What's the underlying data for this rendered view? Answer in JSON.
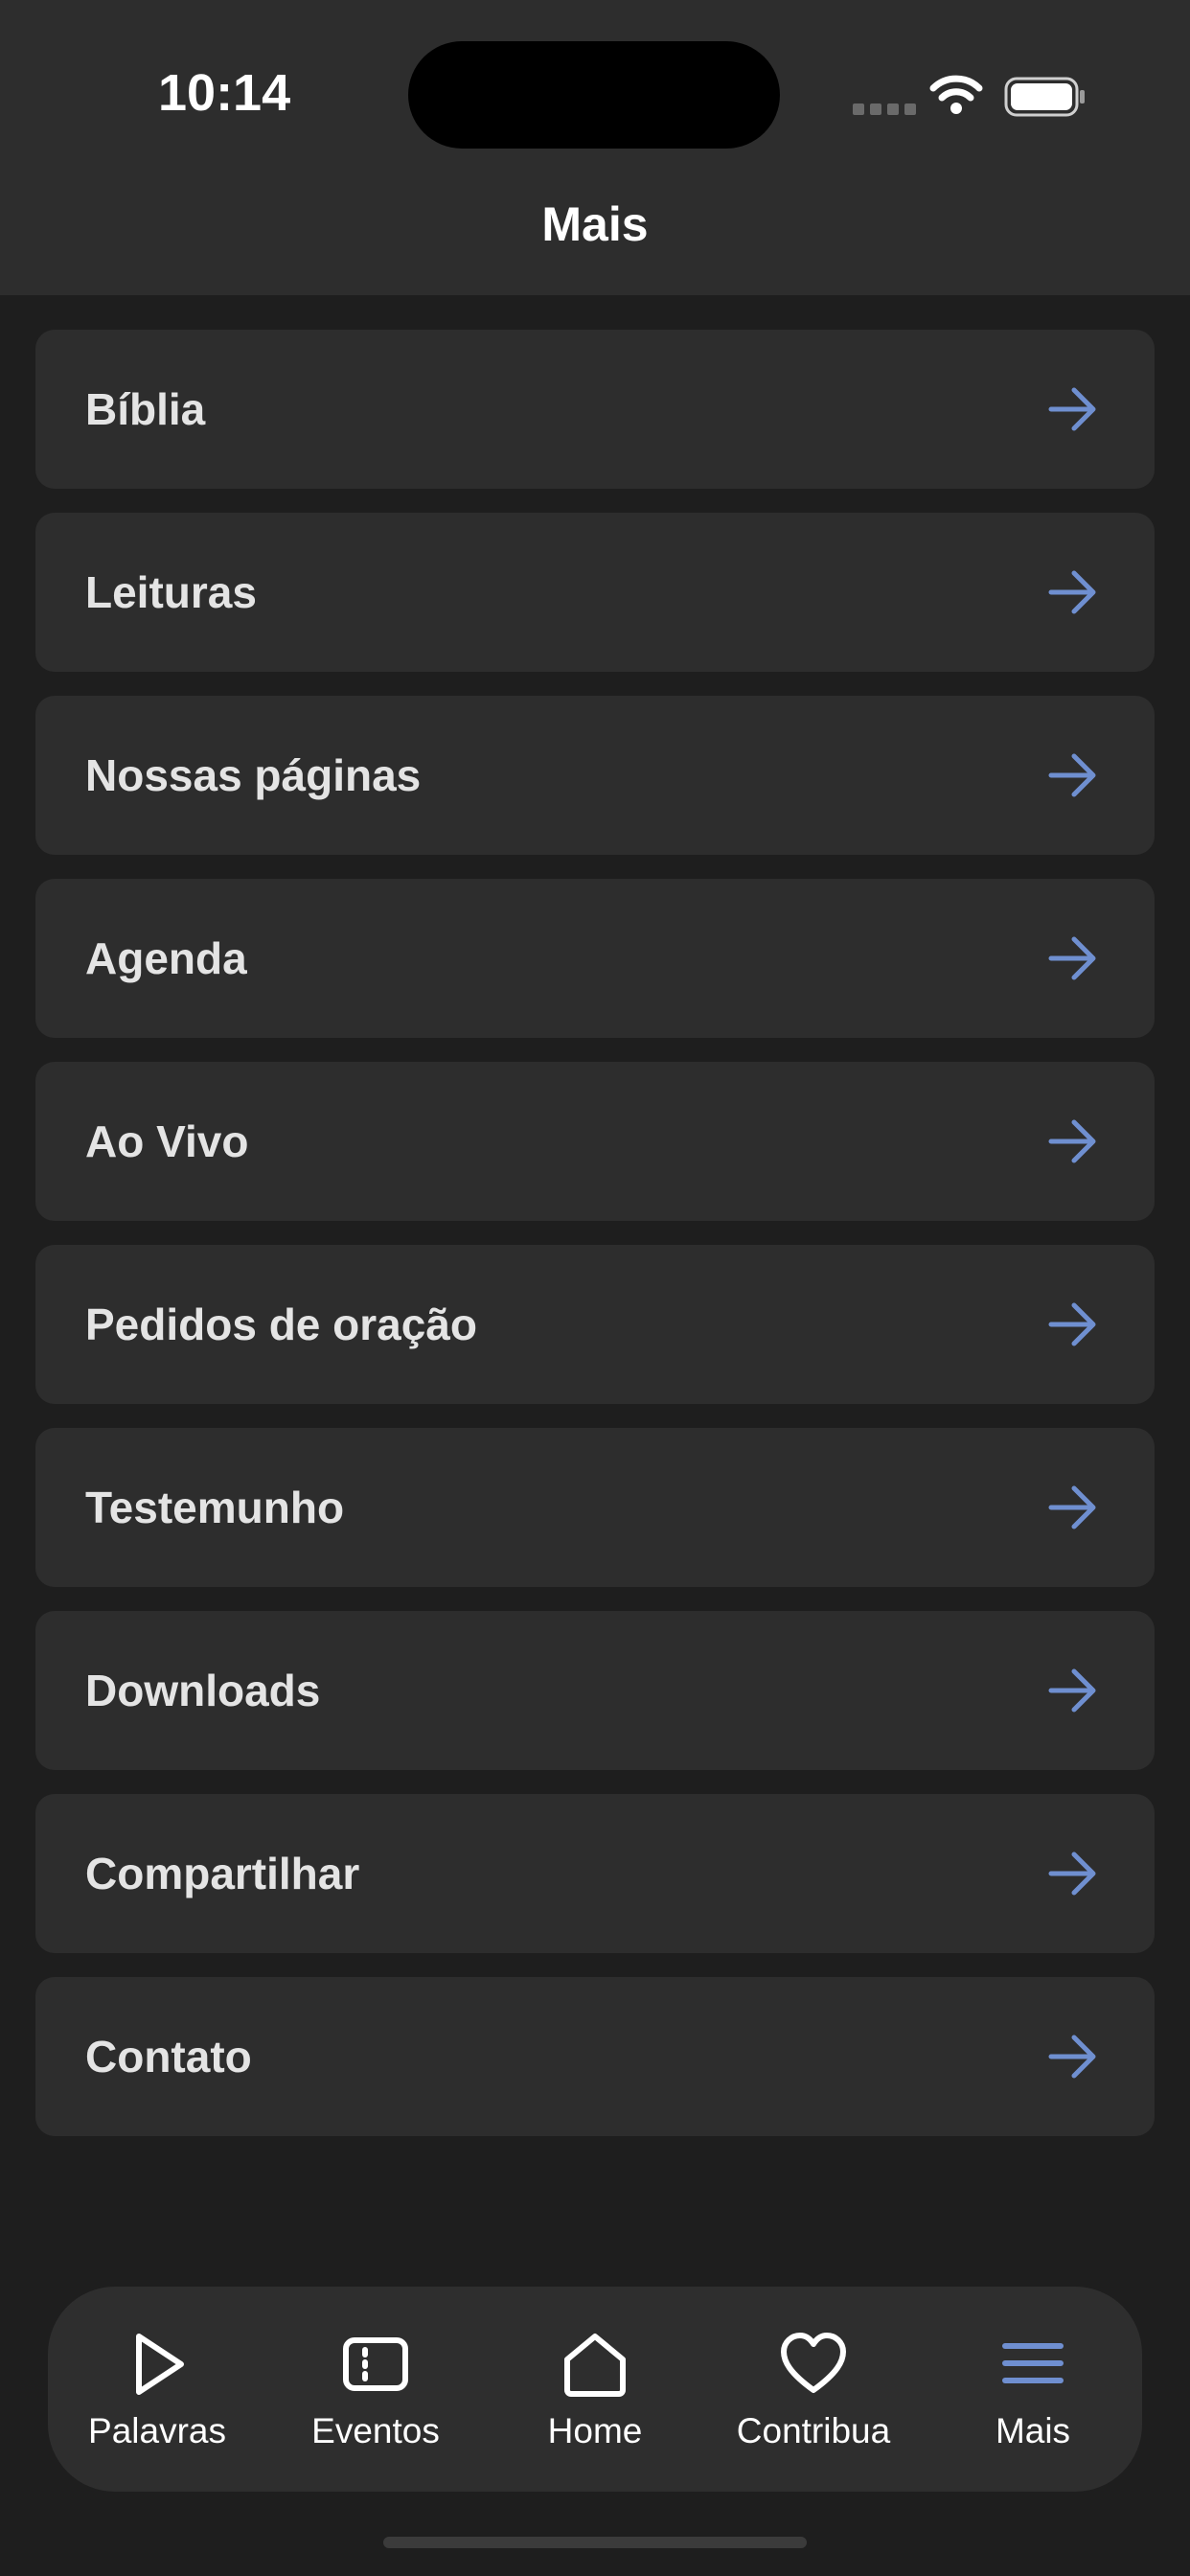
{
  "status_bar": {
    "time": "10:14"
  },
  "header": {
    "title": "Mais"
  },
  "menu": {
    "items": [
      {
        "label": "Bíblia"
      },
      {
        "label": "Leituras"
      },
      {
        "label": "Nossas páginas"
      },
      {
        "label": "Agenda"
      },
      {
        "label": "Ao Vivo"
      },
      {
        "label": "Pedidos de oração"
      },
      {
        "label": "Testemunho"
      },
      {
        "label": "Downloads"
      },
      {
        "label": "Compartilhar"
      },
      {
        "label": "Contato"
      }
    ],
    "arrow_icon": "arrow-right-icon",
    "arrow_color": "#6f8fd0"
  },
  "tabbar": {
    "items": [
      {
        "label": "Palavras",
        "icon": "play-icon"
      },
      {
        "label": "Eventos",
        "icon": "ticket-icon"
      },
      {
        "label": "Home",
        "icon": "home-icon"
      },
      {
        "label": "Contribua",
        "icon": "heart-icon"
      },
      {
        "label": "Mais",
        "icon": "menu-icon",
        "active": true
      }
    ],
    "active_color": "#6f8fd0"
  }
}
